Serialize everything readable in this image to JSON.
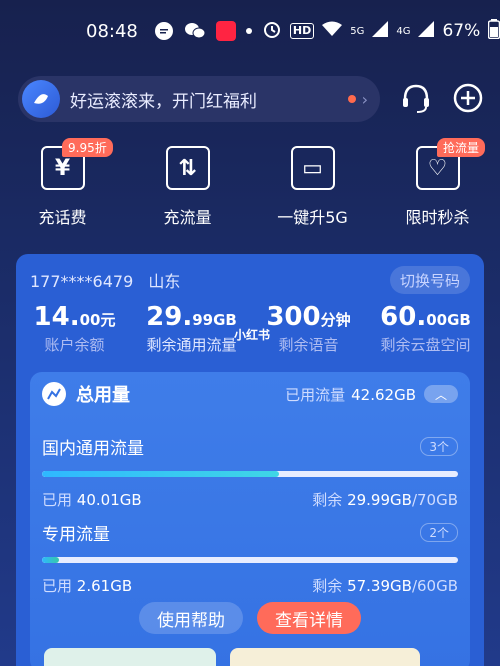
{
  "status_bar": {
    "time": "08:48",
    "hd_badge": "HD",
    "signal_5g": "5G",
    "signal_4g": "4G",
    "battery": "67%"
  },
  "banner": {
    "text": "好运滚滚来，开门红福利",
    "chevron": "›"
  },
  "quick_actions": [
    {
      "label": "充话费",
      "icon": "yen-icon",
      "glyph": "¥",
      "badge": "9.95折"
    },
    {
      "label": "充流量",
      "icon": "data-arrows-icon",
      "glyph": "⇅",
      "badge": ""
    },
    {
      "label": "一键升5G",
      "icon": "router-icon",
      "glyph": "▭",
      "badge": ""
    },
    {
      "label": "限时秒杀",
      "icon": "flash-sale-icon",
      "glyph": "♡",
      "badge": "抢流量"
    }
  ],
  "account": {
    "phone": "177****6479",
    "province": "山东",
    "switch_label": "切换号码"
  },
  "stats": [
    {
      "value": "14.",
      "value_small": "00元",
      "label": "账户余额"
    },
    {
      "value": "29.",
      "value_small": "99GB",
      "label": "剩余通用流量"
    },
    {
      "value": "300",
      "value_small": "分钟",
      "label": "剩余语音"
    },
    {
      "value": "60.",
      "value_small": "00GB",
      "label": "剩余云盘空间"
    }
  ],
  "watermark": "小红书",
  "usage": {
    "title": "总用量",
    "used_label": "已用流量",
    "used_value": "42.62GB",
    "chevron": "︿"
  },
  "flows": [
    {
      "name": "国内通用流量",
      "count": "3个",
      "used_label": "已用",
      "used": "40.01GB",
      "remain_label": "剩余",
      "remain": "29.99GB",
      "total": "/70GB",
      "fraction": 0.57,
      "fill_color": "#3fd6e6"
    },
    {
      "name": "专用流量",
      "count": "2个",
      "used_label": "已用",
      "used": "2.61GB",
      "remain_label": "剩余",
      "remain": "57.39GB",
      "total": "/60GB",
      "fraction": 0.04,
      "fill_color": "#36c9a8"
    }
  ],
  "buttons": {
    "help": "使用帮助",
    "detail": "查看详情"
  },
  "colors": {
    "accent": "#ff6b5a",
    "card": "#2a5fd4"
  }
}
